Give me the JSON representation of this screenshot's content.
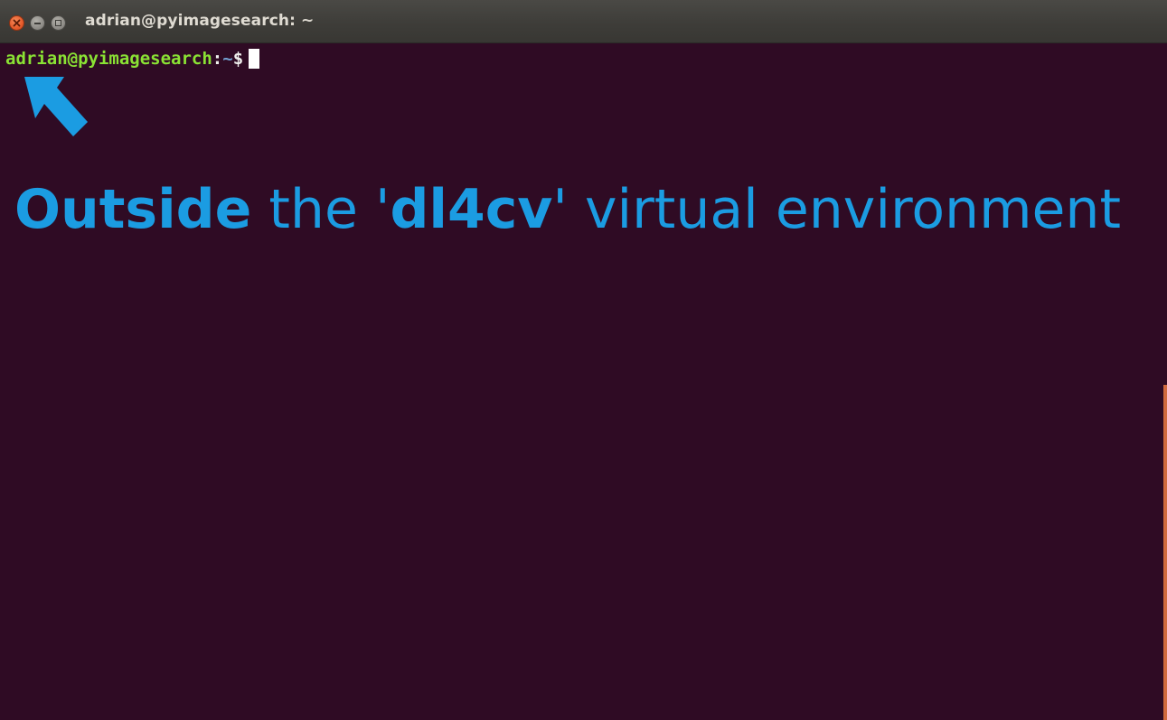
{
  "window": {
    "title": "adrian@pyimagesearch: ~",
    "buttons": {
      "close": "close-icon",
      "minimize": "minimize-icon",
      "maximize": "maximize-icon"
    }
  },
  "terminal": {
    "prompt": {
      "user_host": "adrian@pyimagesearch",
      "colon": ":",
      "path": "~",
      "symbol": "$"
    },
    "colors": {
      "background": "#2f0b24",
      "user_host": "#8ae234",
      "path": "#729fcf",
      "annotation": "#1b9ce2"
    }
  },
  "annotation": {
    "arrow_icon": "arrow-up-left-icon",
    "part1": "Outside",
    "part2": " the '",
    "part3": "dl4cv",
    "part4": "' virtual environment"
  }
}
